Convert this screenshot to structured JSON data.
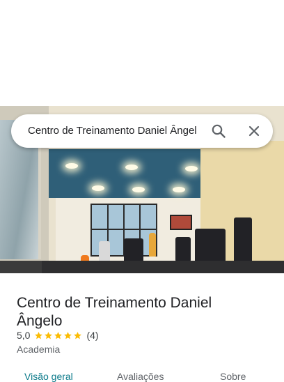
{
  "search": {
    "query": "Centro de Treinamento Daniel Ângel",
    "search_icon": "search-icon",
    "close_icon": "close-icon"
  },
  "photo": {
    "subject": "gym interior photo"
  },
  "place": {
    "name": "Centro de Treinamento Daniel Ângelo",
    "rating": "5,0",
    "stars": 5,
    "reviews_count": "(4)",
    "category": "Academia"
  },
  "tabs": [
    {
      "label": "Visão geral",
      "active": true
    },
    {
      "label": "Avaliações",
      "active": false
    },
    {
      "label": "Sobre",
      "active": false
    }
  ],
  "colors": {
    "accent": "#0b7a8a",
    "star": "#fbbc04",
    "text": "#202124",
    "secondary_text": "#5f6368"
  }
}
